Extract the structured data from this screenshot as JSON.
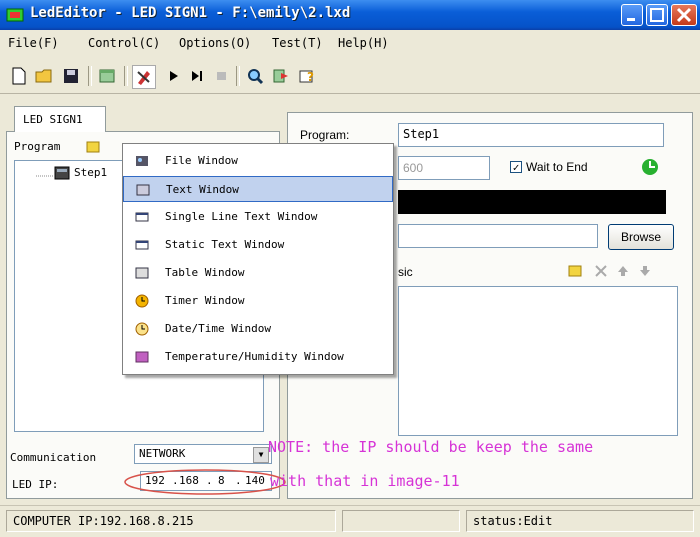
{
  "window": {
    "title": "LedEditor - LED SIGN1 - F:\\emily\\2.lxd"
  },
  "menu": [
    "File(F)",
    "Control(C)",
    "Options(O)",
    "Test(T)",
    "Help(H)"
  ],
  "toolbar": [
    "new-icon",
    "open-icon",
    "save-icon",
    "window-icon",
    "edit-icon",
    "play-icon",
    "step-icon",
    "stop-icon",
    "zoom-icon",
    "export-icon",
    "help-icon"
  ],
  "left": {
    "tab": "LED SIGN1",
    "program_label": "Program",
    "tree_item": "Step1",
    "communication_label": "Communication",
    "communication_value": "NETWORK",
    "ip_label": "LED IP:",
    "ip": [
      "192",
      "168",
      "8",
      "140"
    ]
  },
  "right": {
    "program_label": "Program:",
    "program_value": "Step1",
    "duration_value": "600",
    "wait_to_end": "Wait to End",
    "browse": "Browse",
    "music_label": "sic"
  },
  "context_menu": [
    "File Window",
    "Text Window",
    "Single Line Text Window",
    "Static Text Window",
    "Table Window",
    "Timer Window",
    "Date/Time Window",
    "Temperature/Humidity Window"
  ],
  "annotation": {
    "line1": "NOTE: the IP should be keep the same",
    "line2": "with that in image-11"
  },
  "status": {
    "computer_ip": "COMPUTER IP:192.168.8.215",
    "middle": "",
    "state": "status:Edit"
  },
  "colors": {
    "title_bar": "#0a5ed8",
    "annotation": "#d633d6",
    "highlight": "#c1d2ee"
  }
}
